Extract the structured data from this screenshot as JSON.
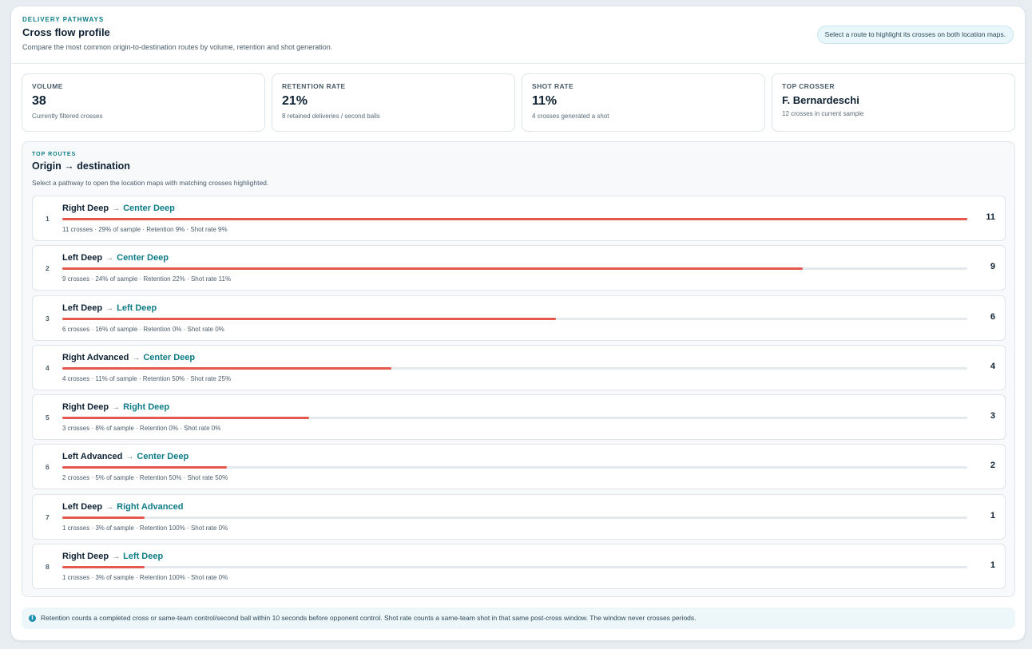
{
  "header": {
    "eyebrow": "DELIVERY PATHWAYS",
    "title": "Cross flow profile",
    "subtitle": "Compare the most common origin-to-destination routes by volume, retention and shot generation.",
    "hint": "Select a route to highlight its crosses on both location maps."
  },
  "cards": [
    {
      "label": "VOLUME",
      "value": "38",
      "sub": "Currently filtered crosses"
    },
    {
      "label": "RETENTION RATE",
      "value": "21%",
      "sub": "8 retained deliveries / second balls"
    },
    {
      "label": "SHOT RATE",
      "value": "11%",
      "sub": "4 crosses generated a shot"
    },
    {
      "label": "TOP CROSSER",
      "value": "F. Bernardeschi",
      "sub": "12 crosses in current sample"
    }
  ],
  "routes": {
    "eyebrow": "TOP ROUTES",
    "title": "Origin → destination",
    "subtitle": "Select a pathway to open the location maps with matching crosses highlighted.",
    "arrow": "→",
    "max": 11,
    "items": [
      {
        "rank": "1",
        "origin": "Right Deep",
        "dest": "Center Deep",
        "meta": "11 crosses · 29% of sample · Retention 9% · Shot rate 9%",
        "count": 11,
        "count_label": "11"
      },
      {
        "rank": "2",
        "origin": "Left Deep",
        "dest": "Center Deep",
        "meta": "9 crosses · 24% of sample · Retention 22% · Shot rate 11%",
        "count": 9,
        "count_label": "9"
      },
      {
        "rank": "3",
        "origin": "Left Deep",
        "dest": "Left Deep",
        "meta": "6 crosses · 16% of sample · Retention 0% · Shot rate 0%",
        "count": 6,
        "count_label": "6"
      },
      {
        "rank": "4",
        "origin": "Right Advanced",
        "dest": "Center Deep",
        "meta": "4 crosses · 11% of sample · Retention 50% · Shot rate 25%",
        "count": 4,
        "count_label": "4"
      },
      {
        "rank": "5",
        "origin": "Right Deep",
        "dest": "Right Deep",
        "meta": "3 crosses · 8% of sample · Retention 0% · Shot rate 0%",
        "count": 3,
        "count_label": "3"
      },
      {
        "rank": "6",
        "origin": "Left Advanced",
        "dest": "Center Deep",
        "meta": "2 crosses · 5% of sample · Retention 50% · Shot rate 50%",
        "count": 2,
        "count_label": "2"
      },
      {
        "rank": "7",
        "origin": "Left Deep",
        "dest": "Right Advanced",
        "meta": "1 crosses · 3% of sample · Retention 100% · Shot rate 0%",
        "count": 1,
        "count_label": "1"
      },
      {
        "rank": "8",
        "origin": "Right Deep",
        "dest": "Left Deep",
        "meta": "1 crosses · 3% of sample · Retention 100% · Shot rate 0%",
        "count": 1,
        "count_label": "1"
      }
    ]
  },
  "footnote": {
    "icon": "info-icon",
    "text": "Retention counts a completed cross or same-team control/second ball within 10 seconds before opponent control. Shot rate counts a same-team shot in that same post-cross window. The window never crosses periods."
  },
  "colors": {
    "accent": "#0e7c86",
    "bar": "#e5574d",
    "track": "#e4e9ed"
  }
}
